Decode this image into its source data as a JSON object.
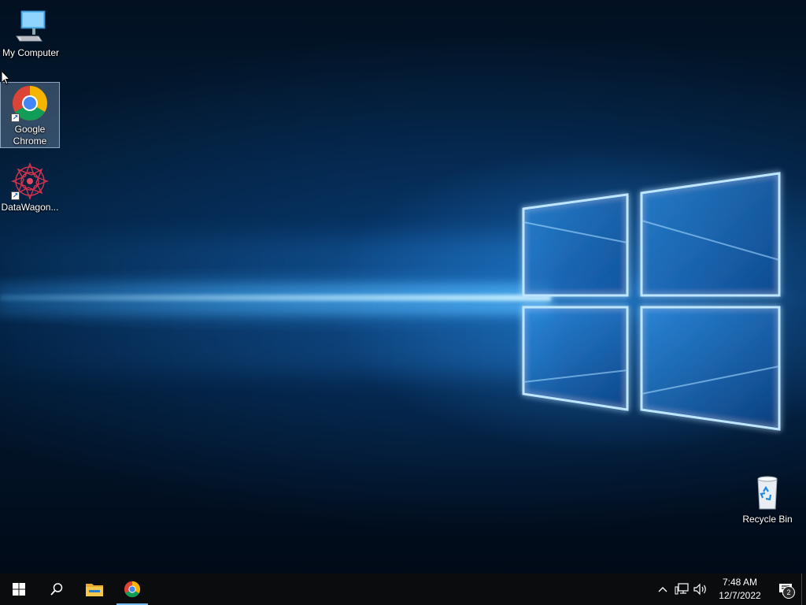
{
  "desktop": {
    "icons": [
      {
        "label": "My Computer",
        "icon": "computer-icon"
      },
      {
        "label": "Google Chrome",
        "icon": "chrome-icon",
        "selected": true,
        "shortcut": true
      },
      {
        "label": "DataWagon...",
        "icon": "datawagon-icon",
        "shortcut": true
      },
      {
        "label": "Recycle Bin",
        "icon": "recycle-bin-icon"
      }
    ]
  },
  "taskbar": {
    "buttons": [
      {
        "name": "start",
        "icon": "windows-logo-icon"
      },
      {
        "name": "search",
        "icon": "search-icon"
      },
      {
        "name": "file-explorer",
        "icon": "folder-icon"
      },
      {
        "name": "chrome",
        "icon": "chrome-icon",
        "active": true
      }
    ],
    "tray": {
      "icons": [
        "chevron-up-icon",
        "network-icon",
        "volume-icon"
      ],
      "time": "7:48 AM",
      "date": "12/7/2022",
      "notification_count": "2"
    }
  },
  "colors": {
    "taskbar": "#0b0c0e",
    "accent": "#76b9ed",
    "wallpaper_glow": "#3aa0f0"
  }
}
